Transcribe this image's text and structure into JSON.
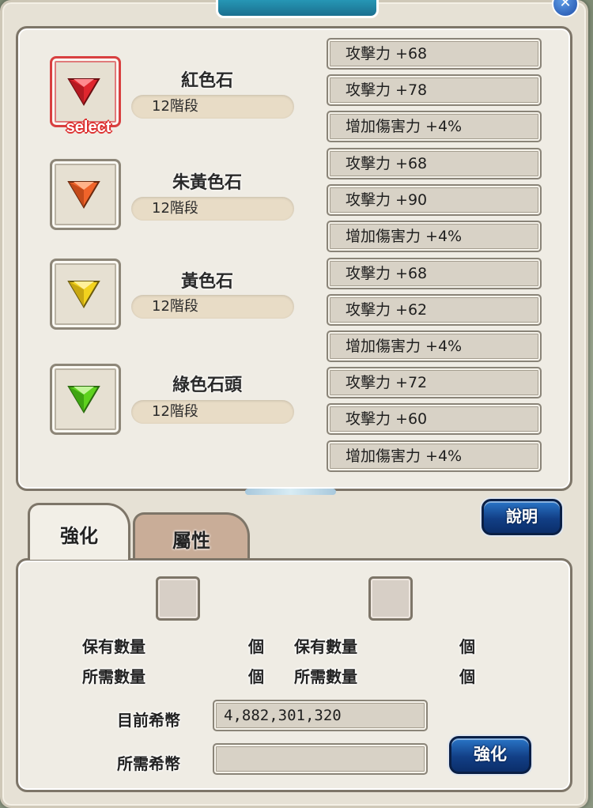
{
  "window": {
    "close_label": "✕"
  },
  "gems": [
    {
      "name": "紅色石",
      "level": "12階段",
      "color": "#e0262e",
      "selected": true,
      "select_label": "select",
      "stats": [
        "攻擊力 +68",
        "攻擊力 +78",
        "增加傷害力 +4%"
      ]
    },
    {
      "name": "朱黃色石",
      "level": "12階段",
      "color": "#f0642a",
      "selected": false,
      "stats": [
        "攻擊力 +68",
        "攻擊力 +90",
        "增加傷害力 +4%"
      ]
    },
    {
      "name": "黃色石",
      "level": "12階段",
      "color": "#f2d21e",
      "selected": false,
      "stats": [
        "攻擊力 +68",
        "攻擊力 +62",
        "增加傷害力 +4%"
      ]
    },
    {
      "name": "綠色石頭",
      "level": "12階段",
      "color": "#5ed21e",
      "selected": false,
      "stats": [
        "攻擊力 +72",
        "攻擊力 +60",
        "增加傷害力 +4%"
      ]
    }
  ],
  "tabs": [
    {
      "label": "強化",
      "active": true
    },
    {
      "label": "屬性",
      "active": false
    }
  ],
  "help_button": "說明",
  "materials": {
    "owned_label": "保有數量",
    "required_label": "所需數量",
    "unit": "個"
  },
  "currency": {
    "current_label": "目前希幣",
    "current_value": "4,882,301,320",
    "required_label": "所需希幣",
    "required_value": ""
  },
  "strengthen_button": "強化"
}
